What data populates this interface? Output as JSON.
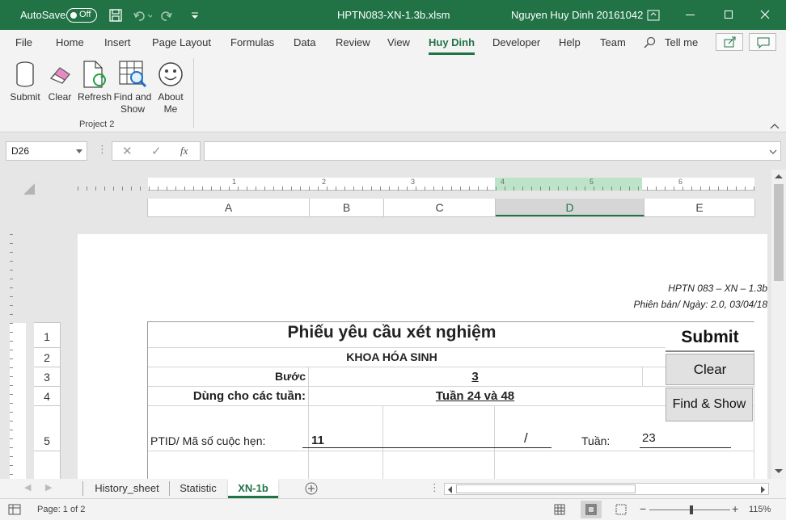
{
  "titlebar": {
    "autosave_label": "AutoSave",
    "autosave_state": "Off",
    "filename": "HPTN083-XN-1.3b.xlsm",
    "user": "Nguyen Huy Dinh 20161042"
  },
  "ribbon_tabs": [
    "File",
    "Home",
    "Insert",
    "Page Layout",
    "Formulas",
    "Data",
    "Review",
    "View",
    "Huy Dinh",
    "Developer",
    "Help",
    "Team"
  ],
  "active_tab": "Huy Dinh",
  "tell_me": "Tell me",
  "ribbon_buttons": {
    "submit": "Submit",
    "clear": "Clear",
    "refresh": "Refresh",
    "find_show_1": "Find and",
    "find_show_2": "Show",
    "about_1": "About",
    "about_2": "Me",
    "group_label": "Project 2"
  },
  "formula_bar": {
    "name_box": "D26",
    "fx": "fx",
    "formula": ""
  },
  "ruler_numbers": [
    "1",
    "2",
    "3",
    "4",
    "5",
    "6"
  ],
  "columns": [
    "A",
    "B",
    "C",
    "D",
    "E"
  ],
  "rows": [
    "1",
    "2",
    "3",
    "4",
    "5"
  ],
  "sheet": {
    "doc_code": "HPTN 083 – XN – 1.3b",
    "version": "Phiên bản/ Ngày: 2.0, 03/04/18",
    "title": "Phiếu yêu cầu xét nghiệm",
    "dept": "KHOA HÓA SINH",
    "step_label": "Bước",
    "step_value": "3",
    "weeks_label": "Dùng cho các tuần:",
    "weeks_value": "Tuần 24 và 48",
    "ptid_label": "PTID/ Mã số cuộc hẹn:",
    "ptid_value": "11",
    "slash": "/",
    "week_label": "Tuần:",
    "week_value": "23"
  },
  "sheet_buttons": {
    "submit": "Submit",
    "clear": "Clear",
    "find_show": "Find & Show"
  },
  "sheet_tabs": [
    "History_sheet",
    "Statistic",
    "XN-1b"
  ],
  "active_sheet": "XN-1b",
  "status": {
    "page": "Page: 1 of 2",
    "zoom": "115%"
  },
  "colors": {
    "accent": "#217346",
    "title_text": "#ffffff"
  }
}
